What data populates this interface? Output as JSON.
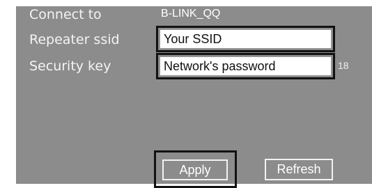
{
  "form": {
    "connect_label": "Connect to",
    "connect_value": "B-LINK_QQ",
    "ssid_label": "Repeater ssid",
    "ssid_value": "Your SSID",
    "key_label": "Security key",
    "key_value": "Network's password",
    "key_length": "18"
  },
  "buttons": {
    "apply_label": "Apply",
    "refresh_label": "Refresh"
  },
  "colors": {
    "panel_background": "#8c8c8c",
    "label_text": "#f4f4f4",
    "field_border": "#121212"
  }
}
